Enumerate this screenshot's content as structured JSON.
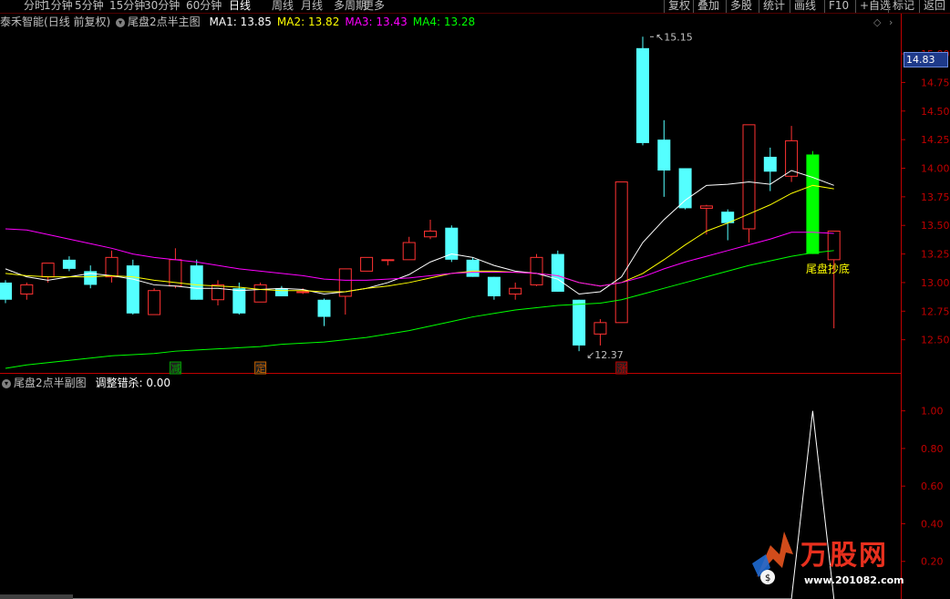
{
  "toolbar": {
    "periods": [
      {
        "label": "分时",
        "active": false
      },
      {
        "label": "1分钟",
        "active": false
      },
      {
        "label": "5分钟",
        "active": false
      },
      {
        "label": "15分钟",
        "active": false
      },
      {
        "label": "30分钟",
        "active": false
      },
      {
        "label": "60分钟",
        "active": false
      },
      {
        "label": "日线",
        "active": true
      },
      {
        "label": "周线",
        "active": false
      },
      {
        "label": "月线",
        "active": false
      },
      {
        "label": "多周期",
        "active": false
      },
      {
        "label": "更多",
        "active": false
      }
    ],
    "right_buttons": [
      "复权",
      "叠加",
      "多股",
      "统计",
      "画线",
      "F10",
      "+自选",
      "标记",
      "返回"
    ]
  },
  "header": {
    "stock_name": "泰禾智能",
    "period_info": "(日线 前复权)",
    "indicator_name": "尾盘2点半主图",
    "ma": [
      {
        "label": "MA1:",
        "value": "13.85",
        "color": "#ffffff"
      },
      {
        "label": "MA2:",
        "value": "13.82",
        "color": "#ffff00"
      },
      {
        "label": "MA3:",
        "value": "13.43",
        "color": "#ff00ff"
      },
      {
        "label": "MA4:",
        "value": "13.28",
        "color": "#00ff00"
      }
    ]
  },
  "sub_header": {
    "indicator_name": "尾盘2点半副图",
    "series_label": "调整错杀:",
    "series_value": "0.00"
  },
  "current_price": "14.83",
  "annotations": {
    "high_label": "15.15",
    "low_label": "12.37",
    "signal_text": "尾盘抄底",
    "markers": [
      "减",
      "定",
      "涨"
    ]
  },
  "colors": {
    "up": "#ff3232",
    "down": "#54ffff",
    "signal": "#00ff00",
    "ma1": "#ffffff",
    "ma2": "#ffff00",
    "ma3": "#ff00ff",
    "ma4": "#00ff00",
    "axis": "#c00000",
    "grid": "#800000"
  },
  "watermark": {
    "brand": "万股网",
    "url": "www.201082.com"
  },
  "chart_data": [
    {
      "type": "candlestick",
      "title": "尾盘2点半主图",
      "ylim": [
        12.25,
        15.2
      ],
      "y_ticks": [
        "15.00",
        "14.75",
        "14.50",
        "14.25",
        "14.00",
        "13.75",
        "13.50",
        "13.25",
        "13.00",
        "12.75",
        "12.50"
      ],
      "candles": [
        {
          "o": 13.0,
          "h": 13.02,
          "l": 12.82,
          "c": 12.85
        },
        {
          "o": 12.9,
          "h": 13.0,
          "l": 12.85,
          "c": 12.98
        },
        {
          "o": 13.05,
          "h": 13.15,
          "l": 13.0,
          "c": 13.17
        },
        {
          "o": 13.2,
          "h": 13.23,
          "l": 13.1,
          "c": 13.12
        },
        {
          "o": 13.1,
          "h": 13.15,
          "l": 12.95,
          "c": 12.98
        },
        {
          "o": 13.05,
          "h": 13.28,
          "l": 13.0,
          "c": 13.22
        },
        {
          "o": 13.15,
          "h": 13.2,
          "l": 12.72,
          "c": 12.73
        },
        {
          "o": 12.72,
          "h": 12.95,
          "l": 12.72,
          "c": 12.93
        },
        {
          "o": 12.97,
          "h": 13.3,
          "l": 12.95,
          "c": 13.2
        },
        {
          "o": 13.15,
          "h": 13.2,
          "l": 12.85,
          "c": 12.85
        },
        {
          "o": 12.85,
          "h": 13.02,
          "l": 12.8,
          "c": 12.98
        },
        {
          "o": 12.95,
          "h": 13.0,
          "l": 12.72,
          "c": 12.73
        },
        {
          "o": 12.83,
          "h": 13.0,
          "l": 12.83,
          "c": 12.98
        },
        {
          "o": 12.95,
          "h": 12.97,
          "l": 12.88,
          "c": 12.88
        },
        {
          "o": 12.92,
          "h": 12.95,
          "l": 12.9,
          "c": 12.92
        },
        {
          "o": 12.85,
          "h": 12.86,
          "l": 12.62,
          "c": 12.7
        },
        {
          "o": 12.88,
          "h": 13.12,
          "l": 12.72,
          "c": 13.12
        },
        {
          "o": 13.1,
          "h": 13.22,
          "l": 13.1,
          "c": 13.22
        },
        {
          "o": 13.2,
          "h": 13.2,
          "l": 13.15,
          "c": 13.2
        },
        {
          "o": 13.2,
          "h": 13.4,
          "l": 13.2,
          "c": 13.35
        },
        {
          "o": 13.4,
          "h": 13.55,
          "l": 13.38,
          "c": 13.45
        },
        {
          "o": 13.48,
          "h": 13.5,
          "l": 13.18,
          "c": 13.2
        },
        {
          "o": 13.2,
          "h": 13.22,
          "l": 13.05,
          "c": 13.05
        },
        {
          "o": 13.05,
          "h": 13.05,
          "l": 12.85,
          "c": 12.88
        },
        {
          "o": 12.9,
          "h": 13.0,
          "l": 12.85,
          "c": 12.95
        },
        {
          "o": 12.98,
          "h": 13.25,
          "l": 12.97,
          "c": 13.22
        },
        {
          "o": 13.25,
          "h": 13.28,
          "l": 12.92,
          "c": 12.92
        },
        {
          "o": 12.85,
          "h": 12.85,
          "l": 12.4,
          "c": 12.45
        },
        {
          "o": 12.55,
          "h": 12.68,
          "l": 12.45,
          "c": 12.65
        },
        {
          "o": 12.65,
          "h": 13.88,
          "l": 12.65,
          "c": 13.88
        },
        {
          "o": 15.05,
          "h": 15.15,
          "l": 14.2,
          "c": 14.22
        },
        {
          "o": 14.25,
          "h": 14.42,
          "l": 13.75,
          "c": 13.98
        },
        {
          "o": 14.0,
          "h": 14.0,
          "l": 13.64,
          "c": 13.65
        },
        {
          "o": 13.65,
          "h": 13.68,
          "l": 13.42,
          "c": 13.67
        },
        {
          "o": 13.62,
          "h": 13.64,
          "l": 13.37,
          "c": 13.52
        },
        {
          "o": 13.47,
          "h": 14.38,
          "l": 13.35,
          "c": 14.38
        },
        {
          "o": 14.1,
          "h": 14.18,
          "l": 13.8,
          "c": 13.97
        },
        {
          "o": 13.93,
          "h": 14.37,
          "l": 13.88,
          "c": 14.24
        },
        {
          "o": 14.12,
          "h": 14.15,
          "l": 13.25,
          "c": 13.25
        },
        {
          "o": 13.2,
          "h": 13.45,
          "l": 12.6,
          "c": 13.45
        }
      ],
      "ma_series": [
        {
          "name": "MA1",
          "values": [
            13.12,
            13.05,
            13.02,
            13.05,
            13.08,
            13.06,
            13.03,
            12.98,
            12.97,
            12.95,
            12.95,
            12.93,
            12.94,
            12.95,
            12.94,
            12.9,
            12.92,
            12.95,
            13.0,
            13.07,
            13.18,
            13.25,
            13.22,
            13.15,
            13.1,
            13.08,
            13.03,
            12.9,
            12.92,
            13.05,
            13.35,
            13.55,
            13.72,
            13.85,
            13.86,
            13.88,
            13.86,
            13.98,
            13.92,
            13.85
          ]
        },
        {
          "name": "MA2",
          "values": [
            13.08,
            13.06,
            13.05,
            13.05,
            13.05,
            13.06,
            13.05,
            13.02,
            13.0,
            12.98,
            12.97,
            12.96,
            12.94,
            12.93,
            12.93,
            12.92,
            12.92,
            12.95,
            12.97,
            13.0,
            13.04,
            13.08,
            13.1,
            13.1,
            13.09,
            13.08,
            13.06,
            13.0,
            12.97,
            13.0,
            13.08,
            13.2,
            13.33,
            13.45,
            13.52,
            13.6,
            13.68,
            13.78,
            13.85,
            13.82
          ]
        },
        {
          "name": "MA3",
          "values": [
            13.47,
            13.46,
            13.42,
            13.38,
            13.34,
            13.3,
            13.25,
            13.22,
            13.2,
            13.18,
            13.15,
            13.12,
            13.1,
            13.08,
            13.06,
            13.03,
            13.02,
            13.02,
            13.03,
            13.04,
            13.06,
            13.08,
            13.09,
            13.09,
            13.09,
            13.08,
            13.06,
            13.0,
            12.97,
            13.0,
            13.05,
            13.12,
            13.18,
            13.23,
            13.28,
            13.33,
            13.38,
            13.44,
            13.44,
            13.43
          ]
        },
        {
          "name": "MA4",
          "values": [
            12.25,
            12.28,
            12.3,
            12.32,
            12.34,
            12.36,
            12.37,
            12.38,
            12.4,
            12.41,
            12.42,
            12.43,
            12.44,
            12.46,
            12.47,
            12.48,
            12.5,
            12.52,
            12.55,
            12.58,
            12.62,
            12.66,
            12.7,
            12.73,
            12.76,
            12.78,
            12.8,
            12.81,
            12.82,
            12.85,
            12.9,
            12.95,
            13.0,
            13.05,
            13.1,
            13.15,
            13.19,
            13.23,
            13.26,
            13.28
          ]
        }
      ]
    },
    {
      "type": "line",
      "title": "尾盘2点半副图",
      "series": [
        {
          "name": "调整错杀",
          "values": [
            0,
            0,
            0,
            0,
            0,
            0,
            0,
            0,
            0,
            0,
            0,
            0,
            0,
            0,
            0,
            0,
            0,
            0,
            0,
            0,
            0,
            0,
            0,
            0,
            0,
            0,
            0,
            0,
            0,
            0,
            0,
            0,
            0,
            0,
            0,
            0,
            0,
            0,
            1,
            0
          ]
        }
      ],
      "ylim": [
        0,
        1.1
      ],
      "y_ticks": [
        "1.00",
        "0.80",
        "0.60",
        "0.40",
        "0.20"
      ]
    }
  ]
}
